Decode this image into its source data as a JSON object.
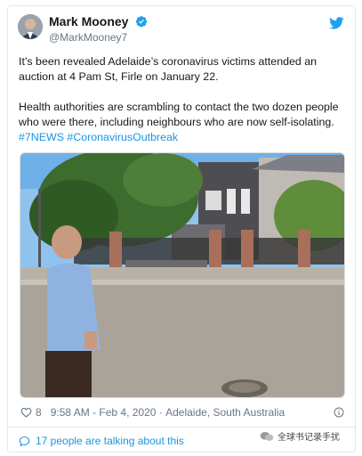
{
  "tweet": {
    "display_name": "Mark Mooney",
    "handle": "@MarkMooney7",
    "paragraph1": "It’s been revealed Adelaide’s coronavirus victims attended an auction at 4 Pam St, Firle on January 22.",
    "paragraph2_text": "Health authorities are scrambling to contact the two dozen people who were there, including neighbours who are now self-isolating.",
    "hashtags": [
      "#7NEWS",
      "#CoronavirusOutbreak"
    ],
    "likes": "8",
    "timestamp": "9:58 AM - Feb 4, 2020",
    "location": "Adelaide, South Australia",
    "talking": "17 people are talking about this"
  },
  "watermark": {
    "text": "全球书记录手扰"
  },
  "icons": {
    "verified": "verified-badge-icon",
    "twitter": "twitter-bird-icon",
    "like": "heart-icon",
    "info": "info-icon",
    "comments": "comment-bubble-icon"
  },
  "colors": {
    "twitter_blue": "#1da1f2",
    "link_blue": "#1b95e0",
    "muted": "#657786"
  }
}
